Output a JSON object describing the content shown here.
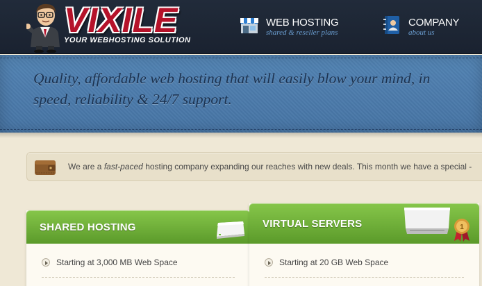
{
  "header": {
    "logo": "VIXILE",
    "tagline": "YOUR WEBHOSTING SOLUTION",
    "nav": [
      {
        "title": "WEB HOSTING",
        "subtitle": "shared & reseller plans",
        "icon": "storefront-icon"
      },
      {
        "title": "COMPANY",
        "subtitle": "about us",
        "icon": "address-book-icon"
      }
    ]
  },
  "banner": {
    "text": "Quality, affordable web hosting that will easily blow your mind, in speed, reliability & 24/7 support."
  },
  "notice": {
    "icon": "wallet-icon",
    "before": "We are a ",
    "emphasis": "fast-paced",
    "after": " hosting company expanding our reaches with new deals. This month we have a special -"
  },
  "plans": [
    {
      "title": "SHARED HOSTING",
      "feature": "Starting at 3,000 MB Web Space"
    },
    {
      "title": "VIRTUAL SERVERS",
      "feature": "Starting at 20 GB Web Space",
      "badge": "1"
    }
  ],
  "colors": {
    "header_bg": "#1e2735",
    "logo_red": "#b5122a",
    "banner_blue": "#4b7bab",
    "nav_sub_blue": "#6b9ed1",
    "plan_green": "#6fae38",
    "page_bg": "#efe8d6"
  }
}
